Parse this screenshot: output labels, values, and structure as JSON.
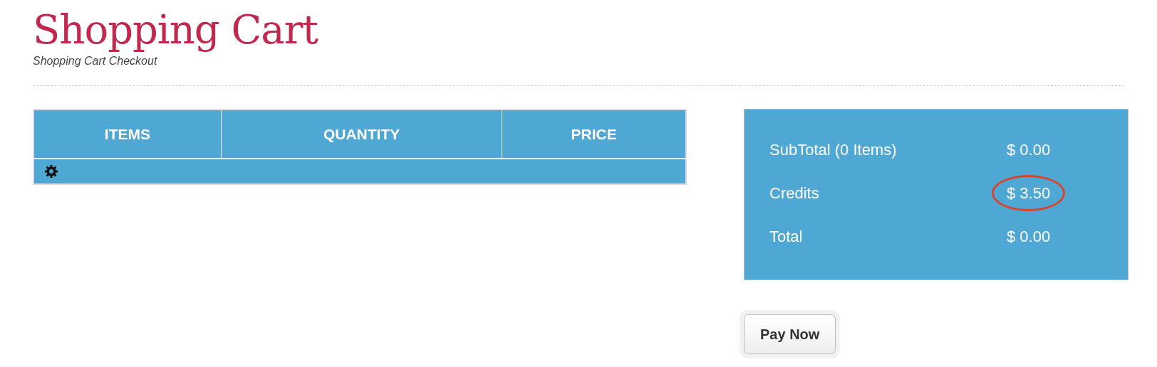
{
  "header": {
    "title": "Shopping Cart",
    "subtitle": "Shopping Cart Checkout"
  },
  "cart_table": {
    "columns": [
      "ITEMS",
      "QUANTITY",
      "PRICE"
    ],
    "loading": true
  },
  "summary": [
    {
      "label": "SubTotal (0 Items)",
      "value": "$ 0.00",
      "circled": false
    },
    {
      "label": "Credits",
      "value": "$ 3.50",
      "circled": true
    },
    {
      "label": "Total",
      "value": "$ 0.00",
      "circled": false
    }
  ],
  "pay_button": {
    "label": "Pay Now"
  }
}
